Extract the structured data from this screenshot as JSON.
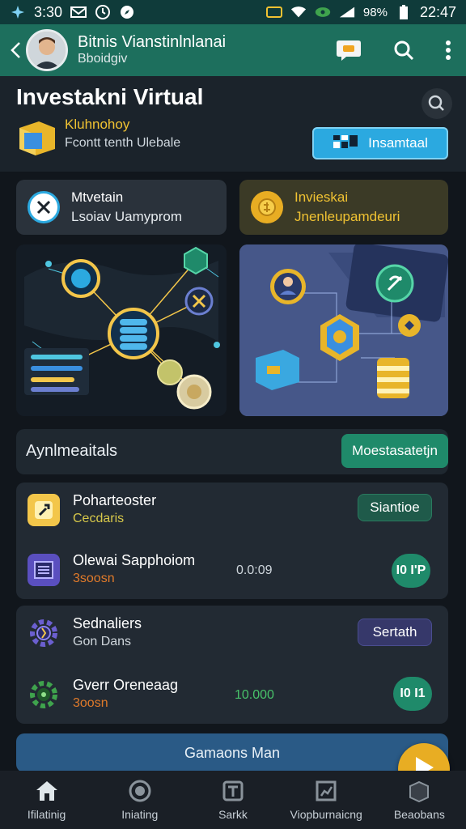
{
  "status_bar": {
    "time_left": "3:30",
    "battery": "98%",
    "time_right": "22:47"
  },
  "app_bar": {
    "title": "Bitnis Vianstinlnlanai",
    "subtitle": "Bboidgiv"
  },
  "header": {
    "title": "Investakni Virtual",
    "sub_highlight": "Kluhnohoy",
    "sub_text": "Fcontt tenth Ulebale",
    "install_label": "Insamtaal"
  },
  "cards": [
    {
      "line1": "Mtvetain",
      "line2": "Lsoiav Uamyprom"
    },
    {
      "line1": "Invieskai",
      "line2": "Jnenleupamdeuri"
    }
  ],
  "section": {
    "title": "Aynlmeaitals",
    "button_label": "Moestasatetjn"
  },
  "group1": [
    {
      "title": "Poharteoster",
      "sub": "Cecdaris",
      "pill": "Siantioe"
    },
    {
      "title": "Olewai  Sapphoiom",
      "sub": "3soosn",
      "amount": "0.0:09",
      "btn": "I0 I'P"
    }
  ],
  "group2": [
    {
      "title": "Sednaliers",
      "sub": "Gon Dans",
      "pill": "Sertath"
    },
    {
      "title": "Gverr Oreneaag",
      "sub": "3oosn",
      "amount": "10.000",
      "btn": "I0 I1"
    }
  ],
  "bottom_bar": {
    "label": "Gamaons Man"
  },
  "nav": [
    {
      "label": "Ifilatinig",
      "icon": "home-icon"
    },
    {
      "label": "Iniating",
      "icon": "target-icon"
    },
    {
      "label": "Sarkk",
      "icon": "store-icon"
    },
    {
      "label": "Viopburnaicng",
      "icon": "chart-icon"
    },
    {
      "label": "Beaobans",
      "icon": "box-icon"
    }
  ],
  "colors": {
    "appbar": "#1d6f5d",
    "accent_green": "#1f8a6a",
    "accent_yellow": "#f0c232",
    "accent_blue": "#2ba9e0",
    "fab": "#e8ad23"
  }
}
